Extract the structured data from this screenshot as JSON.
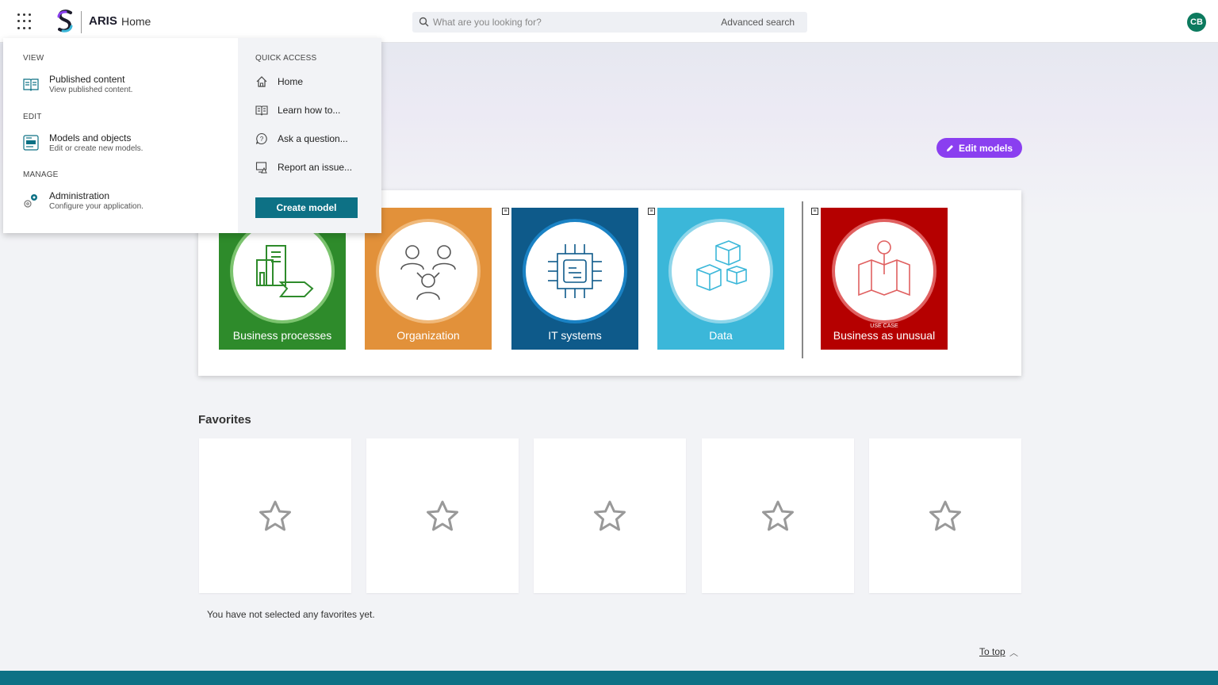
{
  "header": {
    "brand": "ARIS",
    "page": "Home",
    "search_placeholder": "What are you looking for?",
    "advanced_search": "Advanced search",
    "avatar_initials": "CB"
  },
  "hero": {
    "edit_models": "Edit models"
  },
  "tiles": [
    {
      "label": "Business processes",
      "color": "#2e8b2b"
    },
    {
      "label": "Organization",
      "color": "#e2913a"
    },
    {
      "label": "IT systems",
      "color": "#0e5a8a"
    },
    {
      "label": "Data",
      "color": "#3bb7d9"
    },
    {
      "label": "Business as unusual",
      "sublabel": "USE CASE",
      "color": "#b50000"
    }
  ],
  "favorites": {
    "title": "Favorites",
    "empty_text": "You have not selected any favorites yet.",
    "count": 5
  },
  "footer": {
    "to_top": "To top"
  },
  "menu": {
    "view": {
      "label": "VIEW",
      "title": "Published content",
      "subtitle": "View published content."
    },
    "edit": {
      "label": "EDIT",
      "title": "Models and objects",
      "subtitle": "Edit or create new models."
    },
    "manage": {
      "label": "MANAGE",
      "title": "Administration",
      "subtitle": "Configure your application."
    },
    "quick_access": {
      "label": "QUICK ACCESS",
      "items": [
        "Home",
        "Learn how to...",
        "Ask a question...",
        "Report an issue..."
      ],
      "create_model": "Create model"
    }
  }
}
